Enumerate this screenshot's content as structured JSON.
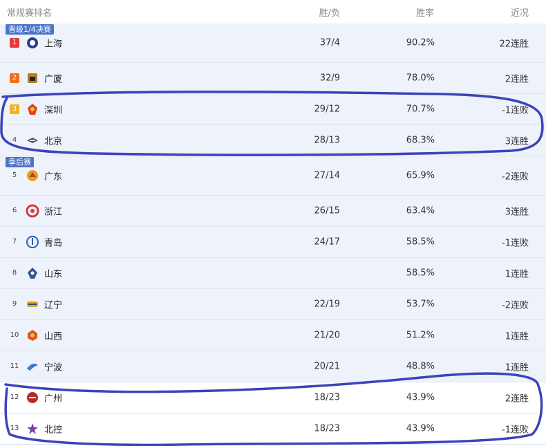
{
  "header": {
    "title": "常规赛排名",
    "record": "胜/负",
    "rate": "胜率",
    "recent": "近况"
  },
  "groups": [
    {
      "label": "晋级1/4决赛"
    },
    {
      "label": "季后赛"
    }
  ],
  "teams": [
    {
      "rank": "1",
      "name": "上海",
      "record": "37/4",
      "rate": "90.2%",
      "recent": "22连胜",
      "logo_color": "#2b3a8c"
    },
    {
      "rank": "2",
      "name": "广厦",
      "record": "32/9",
      "rate": "78.0%",
      "recent": "2连胜",
      "logo_color": "#b0801d"
    },
    {
      "rank": "3",
      "name": "深圳",
      "record": "29/12",
      "rate": "70.7%",
      "recent": "-1连败",
      "logo_color": "#e04222"
    },
    {
      "rank": "4",
      "name": "北京",
      "record": "28/13",
      "rate": "68.3%",
      "recent": "3连胜",
      "logo_color": "#555555"
    },
    {
      "rank": "5",
      "name": "广东",
      "record": "27/14",
      "rate": "65.9%",
      "recent": "-2连败",
      "logo_color": "#e3a21a"
    },
    {
      "rank": "6",
      "name": "浙江",
      "record": "26/15",
      "rate": "63.4%",
      "recent": "3连胜",
      "logo_color": "#d93a3a"
    },
    {
      "rank": "7",
      "name": "青岛",
      "record": "24/17",
      "rate": "58.5%",
      "recent": "-1连败",
      "logo_color": "#2b5fb0"
    },
    {
      "rank": "8",
      "name": "山东",
      "record": "",
      "rate": "58.5%",
      "recent": "1连胜",
      "logo_color": "#33558f"
    },
    {
      "rank": "9",
      "name": "辽宁",
      "record": "22/19",
      "rate": "53.7%",
      "recent": "-2连败",
      "logo_color": "#e0a71e"
    },
    {
      "rank": "10",
      "name": "山西",
      "record": "21/20",
      "rate": "51.2%",
      "recent": "1连胜",
      "logo_color": "#e0551e"
    },
    {
      "rank": "11",
      "name": "宁波",
      "record": "20/21",
      "rate": "48.8%",
      "recent": "1连胜",
      "logo_color": "#3a7ac9"
    },
    {
      "rank": "12",
      "name": "广州",
      "record": "18/23",
      "rate": "43.9%",
      "recent": "2连胜",
      "logo_color": "#b22b2b"
    },
    {
      "rank": "13",
      "name": "北控",
      "record": "18/23",
      "rate": "43.9%",
      "recent": "-1连败",
      "logo_color": "#7b3fa8"
    }
  ],
  "colors": {
    "group_label": "#4b74c9",
    "row_blue": "#eef2fb",
    "ink": "#3d43b8"
  }
}
